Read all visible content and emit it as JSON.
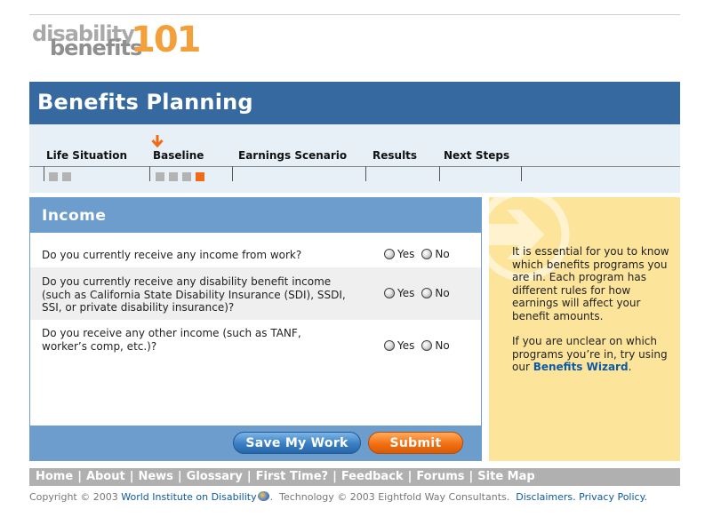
{
  "logo": {
    "line1": "disability",
    "line2": "benefits",
    "number": "101"
  },
  "page_title": "Benefits Planning",
  "steps": [
    {
      "label": "Life Situation"
    },
    {
      "label": "Baseline"
    },
    {
      "label": "Earnings Scenario"
    },
    {
      "label": "Results"
    },
    {
      "label": "Next Steps"
    }
  ],
  "current_step": "Baseline",
  "section_title": "Income",
  "questions": [
    {
      "text": "Do you currently receive any income from work?",
      "yes": "Yes",
      "no": "No"
    },
    {
      "text": "Do you currently receive any disability benefit income (such as California State Disability Insurance (SDI), SSDI, SSI, or private disability insurance)?",
      "yes": "Yes",
      "no": "No"
    },
    {
      "text": "Do you receive any other income (such as TANF, worker’s comp, etc.)?",
      "yes": "Yes",
      "no": "No"
    }
  ],
  "buttons": {
    "save": "Save My Work",
    "submit": "Submit"
  },
  "info": {
    "para1": "It is essential for you to know which  benefits programs you are in. Each program has different rules for how earnings will affect your benefit amounts.",
    "para2_pre": "If you are unclear on which programs you’re in, try using our ",
    "para2_link": "Benefits Wizard",
    "para2_post": "."
  },
  "nav": [
    "Home",
    "About",
    "News",
    "Glossary",
    "First Time?",
    "Feedback",
    "Forums",
    "Site Map"
  ],
  "footer": {
    "copyright_pre": "Copyright © 2003 ",
    "org_link": "World Institute on Disability",
    "tech": ".  Technology © 2003 Eightfold Way Consultants.  ",
    "disclaimers": "Disclaimers.",
    "privacy": "Privacy Policy."
  },
  "colors": {
    "title_bar": "#35699f",
    "panel_header": "#6d9dcd",
    "accent_orange": "#f06a18",
    "info_bg": "#fde49b"
  },
  "icons": {
    "current_step_marker": "down-arrow-icon",
    "info_decoration": "circle-arrow-icon"
  }
}
